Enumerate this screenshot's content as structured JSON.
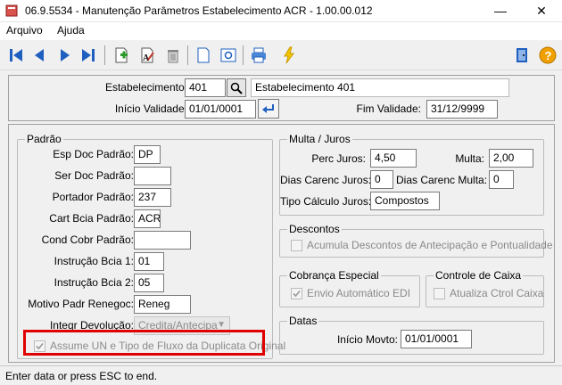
{
  "window": {
    "title": "06.9.5534 - Manutenção Parâmetros Estabelecimento ACR - 1.00.00.012",
    "minimize": "—",
    "close": "✕"
  },
  "menu": {
    "items": [
      "Arquivo",
      "Ajuda"
    ]
  },
  "toolbar": {
    "buttons": [
      "first-icon",
      "previous-icon",
      "next-icon",
      "last-icon",
      "add-icon",
      "edit-icon",
      "delete-icon",
      "new-document-icon",
      "preview-icon",
      "print-icon",
      "execute-icon",
      "exit-icon",
      "help-icon"
    ]
  },
  "header": {
    "estabelecimento_label": "Estabelecimento:",
    "estabelecimento_value": "401",
    "estabelecimento_desc": "Estabelecimento 401",
    "inicio_validade_label": "Início Validade:",
    "inicio_validade_value": "01/01/0001",
    "fim_validade_label": "Fim Validade:",
    "fim_validade_value": "31/12/9999"
  },
  "padrao": {
    "title": "Padrão",
    "esp_doc_label": "Esp Doc Padrão:",
    "esp_doc_value": "DP",
    "ser_doc_label": "Ser Doc Padrão:",
    "ser_doc_value": "",
    "portador_label": "Portador Padrão:",
    "portador_value": "237",
    "cart_bcia_label": "Cart Bcia Padrão:",
    "cart_bcia_value": "ACR",
    "cond_cobr_label": "Cond Cobr Padrão:",
    "cond_cobr_value": "",
    "instr1_label": "Instrução Bcia 1:",
    "instr1_value": "01",
    "instr2_label": "Instrução Bcia 2:",
    "instr2_value": "05",
    "motivo_label": "Motivo Padr Renegoc:",
    "motivo_value": "Reneg",
    "integr_label": "Integr Devolução:",
    "integr_value": "Credita/Antecipa",
    "assume_label": "Assume UN e Tipo de Fluxo da Duplicata Original",
    "assume_checked": true
  },
  "multa_juros": {
    "title": "Multa / Juros",
    "perc_juros_label": "Perc Juros:",
    "perc_juros_value": "4,50",
    "multa_label": "Multa:",
    "multa_value": "2,00",
    "dias_juros_label": "Dias Carenc Juros:",
    "dias_juros_value": "0",
    "dias_multa_label": "Dias Carenc Multa:",
    "dias_multa_value": "0",
    "tipo_calc_label": "Tipo Cálculo Juros:",
    "tipo_calc_value": "Compostos"
  },
  "descontos": {
    "title": "Descontos",
    "acumula_label": "Acumula Descontos de Antecipação e Pontualidade",
    "acumula_checked": false
  },
  "cobranca": {
    "title": "Cobrança Especial",
    "envio_label": "Envio Automático EDI",
    "envio_checked": true
  },
  "controle_caixa": {
    "title": "Controle de Caixa",
    "atualiza_label": "Atualiza Ctrol Caixa",
    "atualiza_checked": false
  },
  "datas": {
    "title": "Datas",
    "inicio_movto_label": "Início Movto:",
    "inicio_movto_value": "01/01/0001"
  },
  "status": {
    "text": "Enter data or press ESC to end."
  },
  "colors": {
    "highlight": "#e00000",
    "toolbar_blue": "#1f5fbf"
  }
}
